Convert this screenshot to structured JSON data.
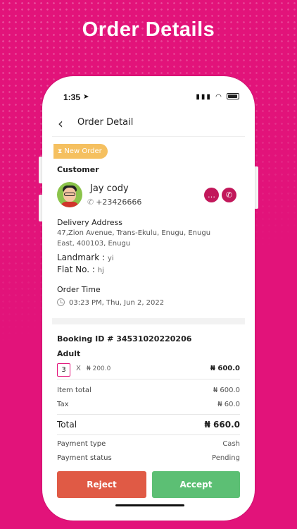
{
  "hero": {
    "title": "Order Details"
  },
  "status_bar": {
    "time": "1:35"
  },
  "topbar": {
    "back_icon": "chevron-left-icon",
    "title": "Order Detail"
  },
  "badge": {
    "label": "New Order",
    "color": "#F5C060"
  },
  "customer": {
    "heading": "Customer",
    "name": "Jay cody",
    "phone": "+23426666"
  },
  "delivery": {
    "heading": "Delivery Address",
    "address_line1": "47,Zion Avenue, Trans-Ekulu, Enugu, Enugu",
    "address_line2": "East, 400103, Enugu",
    "landmark_label": "Landmark :",
    "landmark_value": "yi",
    "flat_label": "Flat No. :",
    "flat_value": "hj"
  },
  "order_time": {
    "heading": "Order Time",
    "value": "03:23 PM, Thu, Jun 2, 2022"
  },
  "booking": {
    "id_text": "Booking ID # 34531020220206",
    "item_name": "Adult",
    "qty": "3",
    "multiply": "X",
    "unit_price": "₦ 200.0",
    "line_total": "₦ 600.0"
  },
  "totals": {
    "item_total_label": "Item total",
    "item_total_value": "₦ 600.0",
    "tax_label": "Tax",
    "tax_value": "₦ 60.0",
    "total_label": "Total",
    "total_value": "₦ 660.0"
  },
  "payment": {
    "type_label": "Payment type",
    "type_value": "Cash",
    "status_label": "Payment status",
    "status_value": "Pending"
  },
  "actions": {
    "reject_label": "Reject",
    "accept_label": "Accept"
  },
  "colors": {
    "brand": "#E2137A",
    "action_icon": "#C2185B",
    "reject": "#E05A45",
    "accept": "#5CBF74"
  }
}
